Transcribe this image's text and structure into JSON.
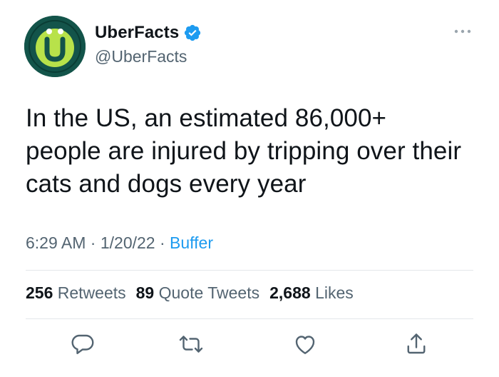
{
  "author": {
    "display_name": "UberFacts",
    "handle": "@UberFacts",
    "verified": true,
    "avatar_letter": "U"
  },
  "tweet": {
    "text_lines": [
      "In the US, an estimated 86,000+",
      "people are injured by tripping over their",
      "cats and dogs every year"
    ],
    "time": "6:29 AM",
    "separator": "·",
    "date": "1/20/22",
    "source": "Buffer"
  },
  "stats": {
    "retweets_count": "256",
    "retweets_label": "Retweets",
    "quote_tweets_count": "89",
    "quote_tweets_label": "Quote Tweets",
    "likes_count": "2,688",
    "likes_label": "Likes"
  },
  "actions": {
    "icons": [
      "reply-icon",
      "retweet-icon",
      "like-icon",
      "share-icon"
    ]
  },
  "colors": {
    "avatar_bg": "#13544a",
    "avatar_accent": "#b8e24a",
    "verified_blue": "#1d9bf0",
    "muted_text": "#536471",
    "link_blue": "#1d9bf0"
  }
}
